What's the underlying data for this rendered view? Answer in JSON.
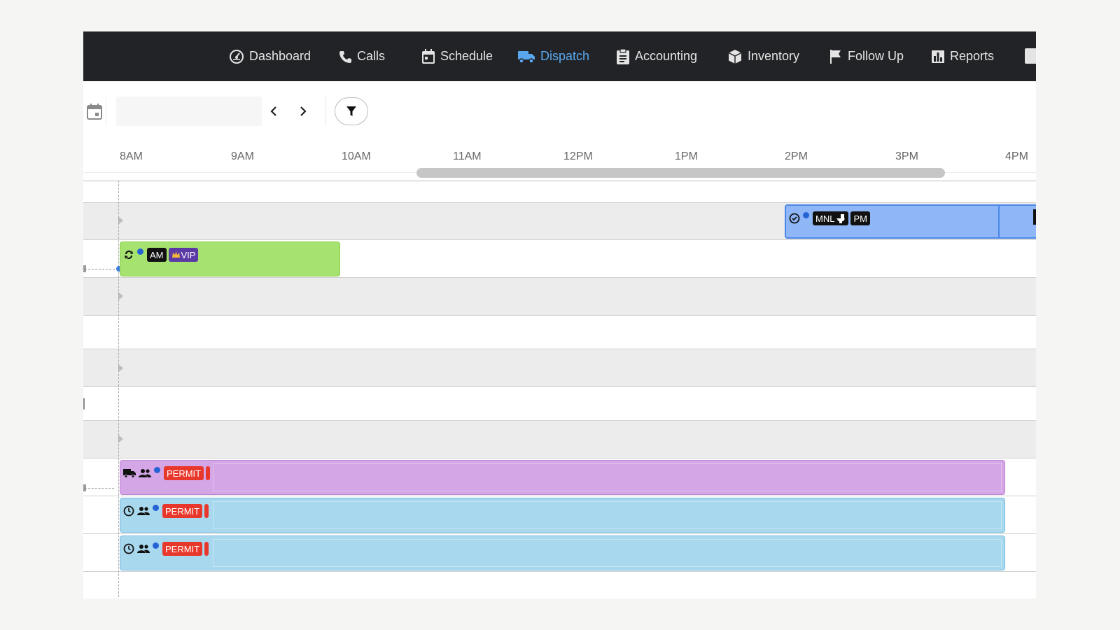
{
  "nav": {
    "items": [
      {
        "label": "Dashboard",
        "icon": "dashboard-icon"
      },
      {
        "label": "Calls",
        "icon": "phone-icon"
      },
      {
        "label": "Schedule",
        "icon": "calendar-icon"
      },
      {
        "label": "Dispatch",
        "icon": "truck-icon",
        "active": true
      },
      {
        "label": "Accounting",
        "icon": "clipboard-icon"
      },
      {
        "label": "Inventory",
        "icon": "box-icon"
      },
      {
        "label": "Follow Up",
        "icon": "flag-icon"
      },
      {
        "label": "Reports",
        "icon": "bar-chart-icon"
      }
    ],
    "active_color": "#5aa7ee"
  },
  "toolbar": {
    "date_value": "",
    "prev_icon": "chevron-left-icon",
    "next_icon": "chevron-right-icon",
    "filter_icon": "filter-icon"
  },
  "timeline": {
    "ticks": [
      "8AM",
      "9AM",
      "10AM",
      "11AM",
      "12PM",
      "1PM",
      "2PM",
      "3PM",
      "4PM"
    ]
  },
  "jobs": {
    "green": {
      "badges": [
        "AM",
        "VIP"
      ],
      "icons": [
        "repeat-icon",
        "status-dot"
      ],
      "color": "#a6e26f"
    },
    "blue": {
      "badges": [
        "MNL",
        "PM"
      ],
      "icons": [
        "check-circle-icon",
        "status-dot"
      ],
      "color": "#8fb7f8"
    },
    "purple": {
      "badges": [
        "PERMIT"
      ],
      "icons": [
        "truck-icon",
        "crew-icon",
        "status-dot"
      ],
      "color": "#d4a6e6"
    },
    "cyan1": {
      "badges": [
        "PERMIT"
      ],
      "icons": [
        "clock-icon",
        "crew-icon",
        "status-dot"
      ],
      "color": "#a8d8ee"
    },
    "cyan2": {
      "badges": [
        "PERMIT"
      ],
      "icons": [
        "clock-icon",
        "crew-icon",
        "status-dot"
      ],
      "color": "#a8d8ee"
    }
  },
  "colors": {
    "nav_bg": "#222326",
    "permit_red": "#e8382b",
    "vip_purple": "#5b3aa6",
    "dot_blue": "#2563d4"
  }
}
